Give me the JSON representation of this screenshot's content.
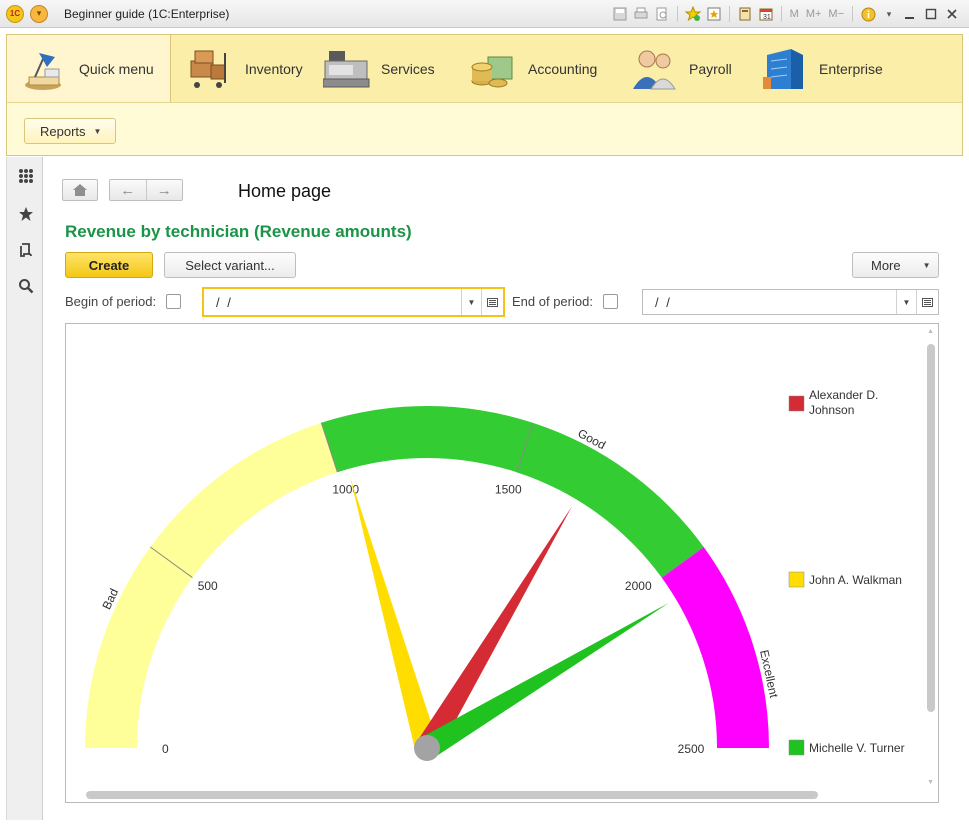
{
  "window": {
    "logo_text": "1C",
    "title": "Beginner guide  (1C:Enterprise)",
    "m_buttons": [
      "M",
      "M+",
      "M−"
    ]
  },
  "sections": [
    {
      "label": "Quick menu",
      "icon": "desk-lamp-icon",
      "active": true
    },
    {
      "label": "Inventory",
      "icon": "boxes-cart-icon",
      "active": false
    },
    {
      "label": "Services",
      "icon": "cash-register-icon",
      "active": false
    },
    {
      "label": "Accounting",
      "icon": "coins-icon",
      "active": false
    },
    {
      "label": "Payroll",
      "icon": "people-icon",
      "active": false
    },
    {
      "label": "Enterprise",
      "icon": "building-icon",
      "active": false
    }
  ],
  "subpanel": {
    "reports_label": "Reports"
  },
  "main": {
    "page_title": "Home page",
    "report_title": "Revenue by technician (Revenue amounts)",
    "create_label": "Create",
    "select_variant_label": "Select variant...",
    "more_label": "More",
    "begin_label": "Begin of period:",
    "begin_value": " /  /",
    "end_label": "End of period:",
    "end_value": " /  /"
  },
  "colors": {
    "report_title": "#1a9447",
    "band_bad": "#ffff99",
    "band_good": "#33cc33",
    "band_excellent": "#ff00ff",
    "needle_alexander": "#d42b34",
    "needle_john": "#ffdd00",
    "needle_michelle": "#1fc21f"
  },
  "chart_data": {
    "type": "gauge",
    "min": 0,
    "max": 2500,
    "ticks": [
      0,
      500,
      1000,
      1500,
      2000,
      2500
    ],
    "bands": [
      {
        "label": "Bad",
        "from": 0,
        "to": 1000,
        "color": "#ffff99"
      },
      {
        "label": "Good",
        "from": 1000,
        "to": 2000,
        "color": "#33cc33"
      },
      {
        "label": "Excellent",
        "from": 2000,
        "to": 2500,
        "color": "#ff00ff"
      }
    ],
    "series": [
      {
        "name": "Alexander D. Johnson",
        "value": 1680,
        "color": "#d42b34"
      },
      {
        "name": "John A. Walkman",
        "value": 1030,
        "color": "#ffdd00"
      },
      {
        "name": "Michelle V. Turner",
        "value": 2070,
        "color": "#1fc21f"
      }
    ],
    "legend": "right"
  }
}
